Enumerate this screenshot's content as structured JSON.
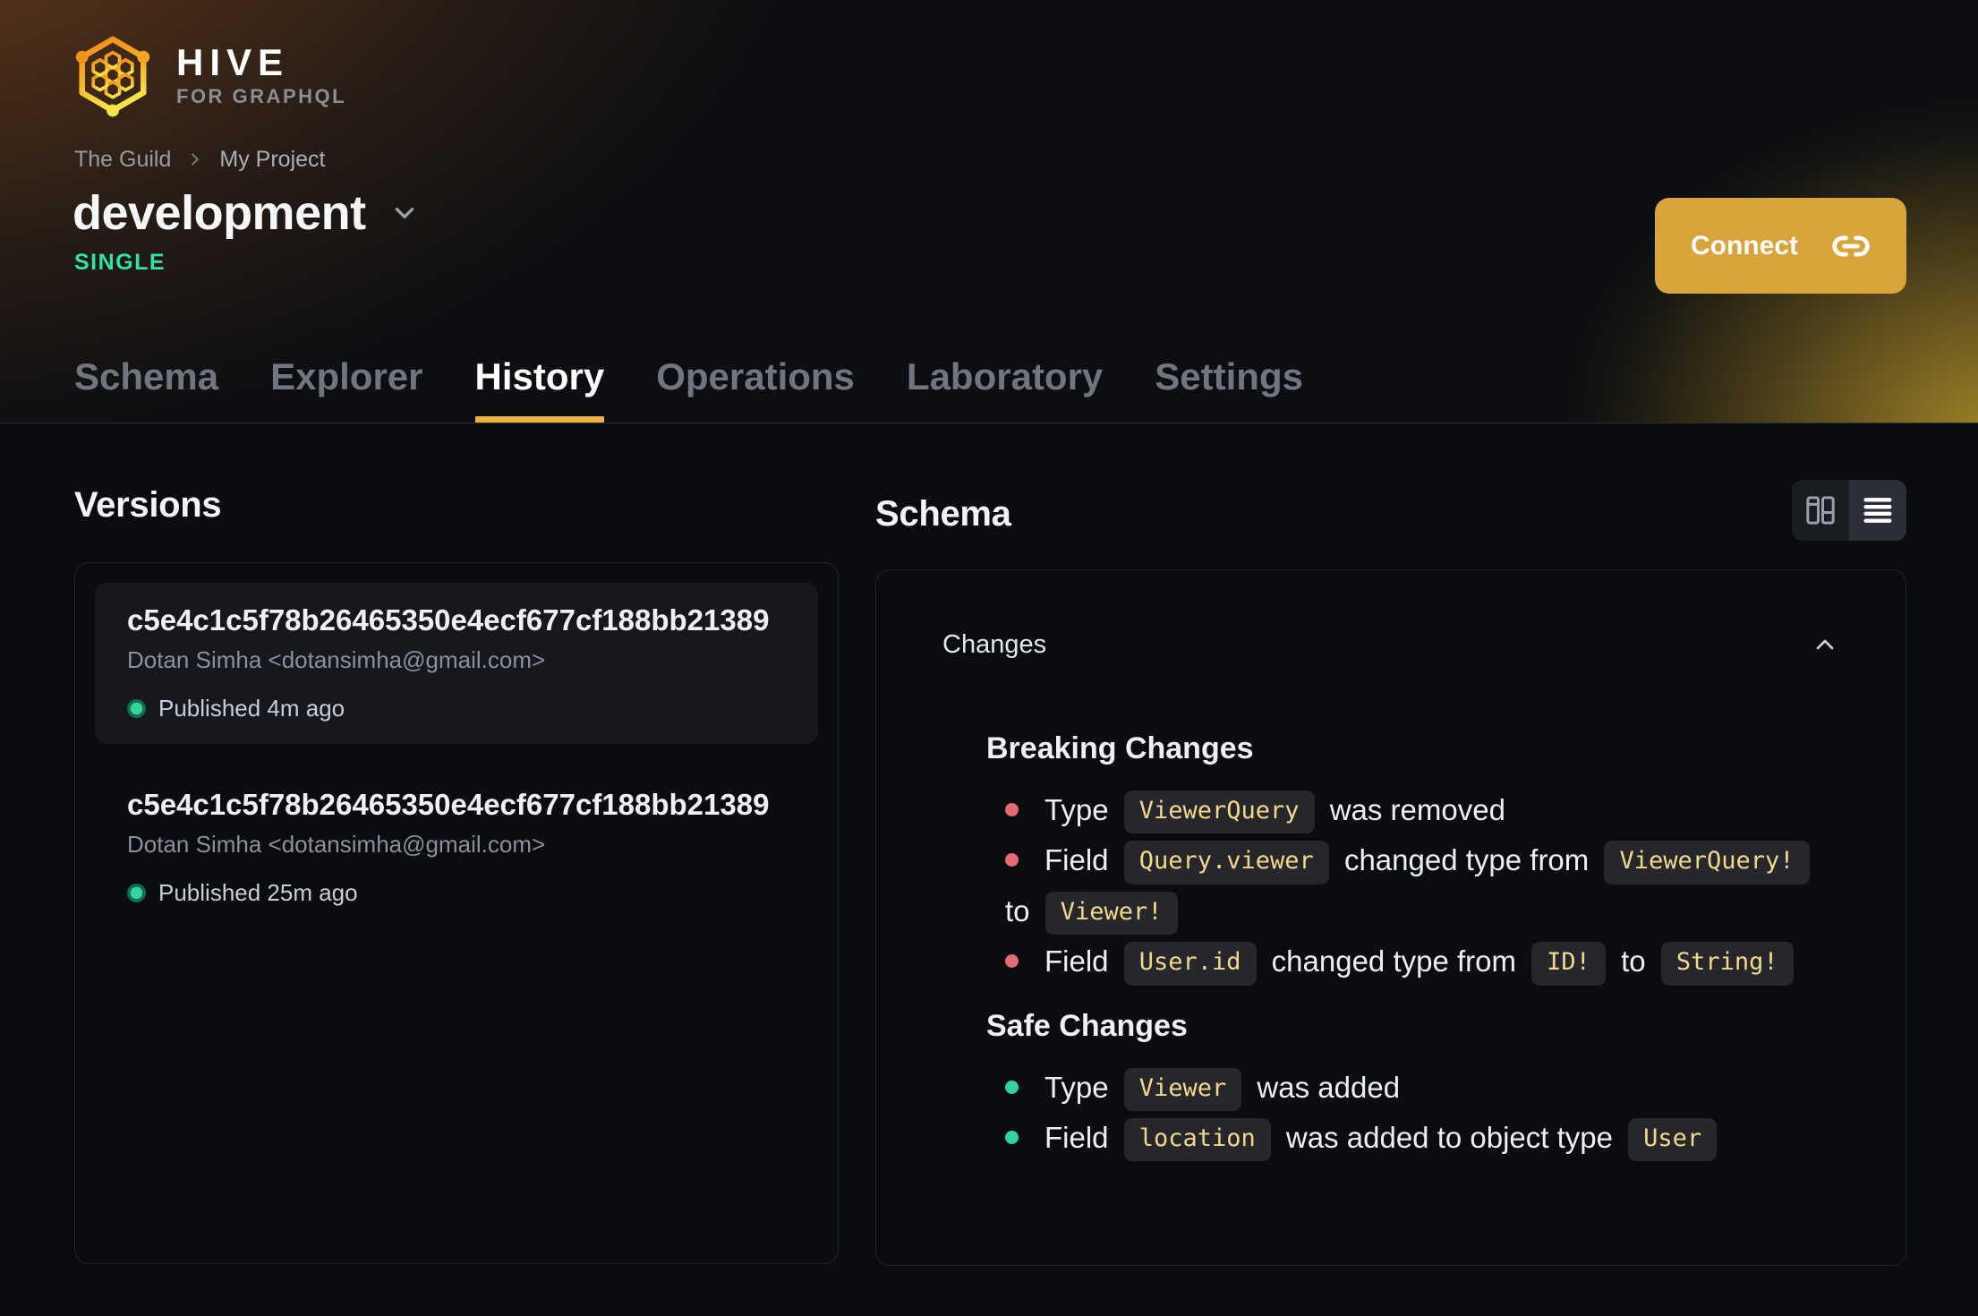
{
  "brand": {
    "name": "HIVE",
    "tagline": "FOR GRAPHQL"
  },
  "breadcrumb": {
    "org": "The Guild",
    "project": "My Project"
  },
  "target": {
    "name": "development",
    "type_badge": "SINGLE"
  },
  "header": {
    "connect_label": "Connect"
  },
  "tabs": [
    {
      "label": "Schema"
    },
    {
      "label": "Explorer"
    },
    {
      "label": "History"
    },
    {
      "label": "Operations"
    },
    {
      "label": "Laboratory"
    },
    {
      "label": "Settings"
    }
  ],
  "versions": {
    "heading": "Versions",
    "items": [
      {
        "hash": "c5e4c1c5f78b26465350e4ecf677cf188bb21389",
        "author": "Dotan Simha <dotansimha@gmail.com>",
        "status": "Published 4m ago"
      },
      {
        "hash": "c5e4c1c5f78b26465350e4ecf677cf188bb21389",
        "author": "Dotan Simha <dotansimha@gmail.com>",
        "status": "Published 25m ago"
      }
    ]
  },
  "schema_panel": {
    "heading": "Schema",
    "changes_label": "Changes",
    "breaking": {
      "heading": "Breaking Changes",
      "items": [
        {
          "p0": "Type ",
          "c0": "ViewerQuery",
          "p1": " was removed"
        },
        {
          "p0": "Field ",
          "c0": "Query.viewer",
          "p1": " changed type from ",
          "c1": "ViewerQuery!",
          "p2": "to ",
          "c2": "Viewer!"
        },
        {
          "p0": "Field ",
          "c0": "User.id",
          "p1": " changed type from ",
          "c1": "ID!",
          "p2": " to ",
          "c2": "String!"
        }
      ]
    },
    "safe": {
      "heading": "Safe Changes",
      "items": [
        {
          "p0": "Type ",
          "c0": "Viewer",
          "p1": " was added"
        },
        {
          "p0": "Field ",
          "c0": "location",
          "p1": " was added to object type ",
          "c1": "User"
        }
      ]
    }
  },
  "icons": {
    "logo": "hive-honeycomb-hexagon",
    "connect": "link-icon",
    "title_menu": "chevron-down-icon",
    "breadcrumb_sep": "chevron-right-icon",
    "view_columns": "columns-view-icon",
    "view_list": "list-view-icon",
    "collapse": "chevron-up-icon"
  },
  "colors": {
    "accent_underline": "#ecb23c",
    "connect_bg": "#d9a43c",
    "badge_green": "#2de4a6",
    "published_green": "#36d49d",
    "breaking_red": "#e56b73",
    "safe_green": "#2ed3a0",
    "code_text": "#f3d88c",
    "code_bg": "#25272c",
    "background": "#0a0c0f"
  }
}
